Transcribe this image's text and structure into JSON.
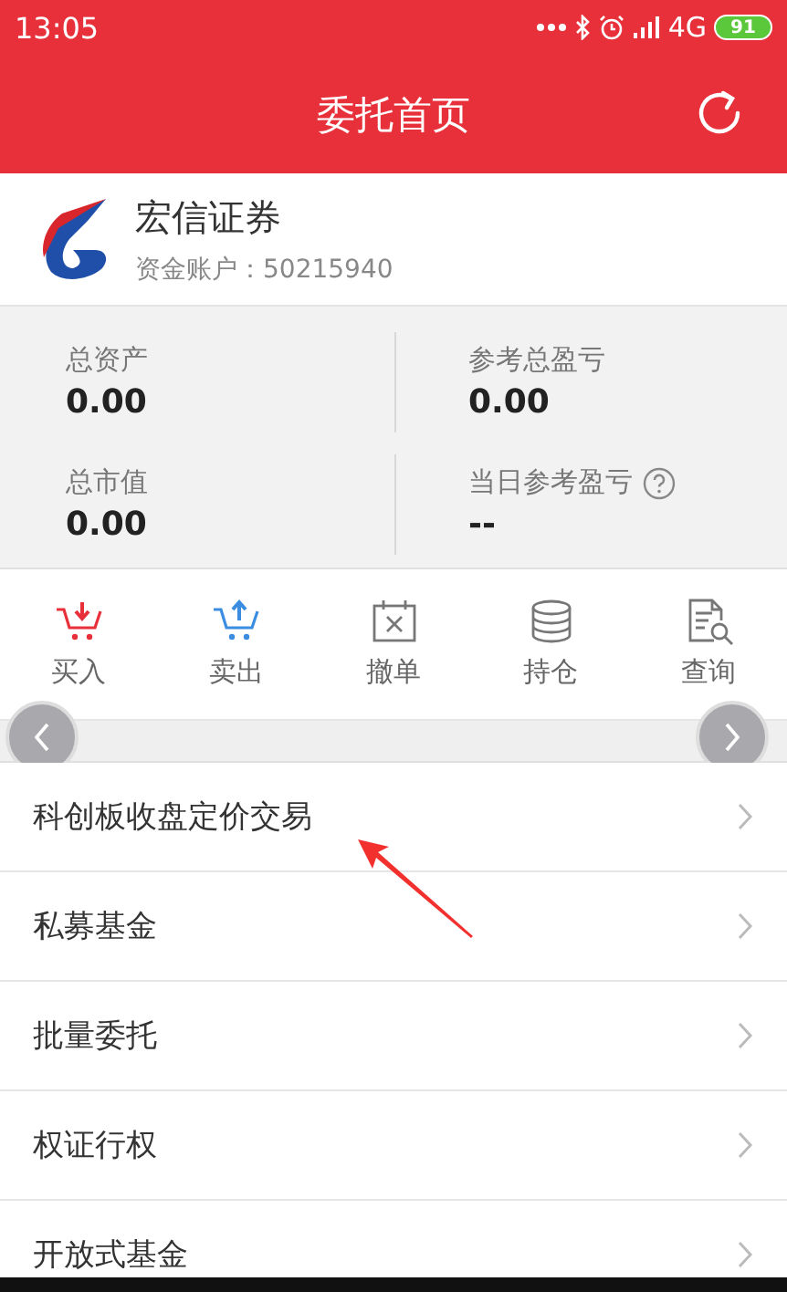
{
  "status_bar": {
    "time": "13:05",
    "network": "4G",
    "battery": "91"
  },
  "header": {
    "title": "委托首页"
  },
  "account": {
    "broker": "宏信证券",
    "account_label": "资金账户：50215940"
  },
  "summary": [
    {
      "label": "总资产",
      "value": "0.00",
      "help": false
    },
    {
      "label": "参考总盈亏",
      "value": "0.00",
      "help": false
    },
    {
      "label": "总市值",
      "value": "0.00",
      "help": false
    },
    {
      "label": "当日参考盈亏",
      "value": "--",
      "help": true
    }
  ],
  "actions": [
    {
      "kind": "buy",
      "label": "买入",
      "color": "#e8303a"
    },
    {
      "kind": "sell",
      "label": "卖出",
      "color": "#3a8de0"
    },
    {
      "kind": "cancel",
      "label": "撤单",
      "color": "#777777"
    },
    {
      "kind": "holdings",
      "label": "持仓",
      "color": "#777777"
    },
    {
      "kind": "query",
      "label": "查询",
      "color": "#777777"
    }
  ],
  "menu": [
    {
      "label": "科创板收盘定价交易"
    },
    {
      "label": "私募基金"
    },
    {
      "label": "批量委托"
    },
    {
      "label": "权证行权"
    },
    {
      "label": "开放式基金"
    }
  ],
  "annotation": {
    "kind": "arrow"
  }
}
